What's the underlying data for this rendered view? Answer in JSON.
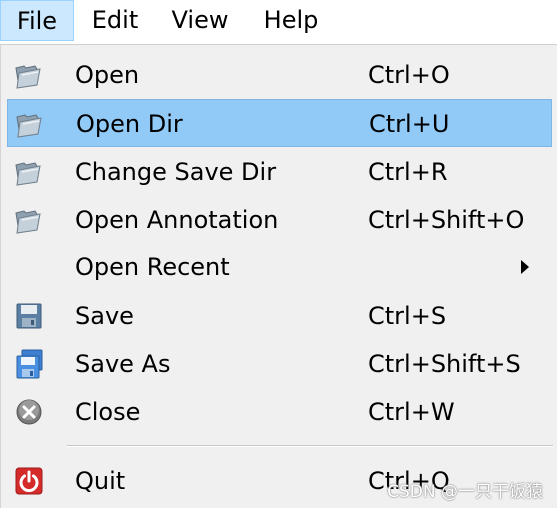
{
  "menubar": {
    "items": [
      {
        "label": "File",
        "active": true
      },
      {
        "label": "Edit",
        "active": false
      },
      {
        "label": "View",
        "active": false
      },
      {
        "label": "Help",
        "active": false
      }
    ]
  },
  "menu": {
    "highlighted_item": "Open Dir",
    "items": [
      {
        "label": "Open",
        "shortcut": "Ctrl+O",
        "icon": "folder-icon"
      },
      {
        "label": "Open Dir",
        "shortcut": "Ctrl+U",
        "icon": "folder-icon"
      },
      {
        "label": "Change Save Dir",
        "shortcut": "Ctrl+R",
        "icon": "folder-icon"
      },
      {
        "label": "Open Annotation",
        "shortcut": "Ctrl+Shift+O",
        "icon": "folder-icon"
      },
      {
        "label": "Open Recent",
        "shortcut": "",
        "icon": "",
        "submenu": true
      },
      {
        "label": "Save",
        "shortcut": "Ctrl+S",
        "icon": "save-icon"
      },
      {
        "label": "Save As",
        "shortcut": "Ctrl+Shift+S",
        "icon": "save-as-icon"
      },
      {
        "label": "Close",
        "shortcut": "Ctrl+W",
        "icon": "close-icon"
      },
      {
        "label": "Quit",
        "shortcut": "Ctrl+Q",
        "icon": "quit-icon"
      }
    ]
  },
  "watermark": "CSDN @一只干饭猿",
  "colors": {
    "highlight": "#91c9f7",
    "menubar_active": "#cce8ff",
    "menu_background": "#f0f0f0"
  }
}
